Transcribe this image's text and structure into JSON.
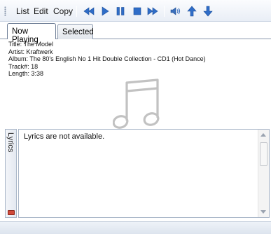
{
  "menu": {
    "list": "List",
    "edit": "Edit",
    "copy": "Copy"
  },
  "toolbar_icons": [
    "rewind-icon",
    "play-icon",
    "pause-icon",
    "stop-icon",
    "fast-forward-icon",
    "volume-icon",
    "arrow-up-icon",
    "arrow-down-icon"
  ],
  "colors": {
    "accent": "#3f7fd1",
    "icon_blue": "#2f6dc8"
  },
  "tabs": {
    "now_playing": "Now Playing",
    "selected": "Selected"
  },
  "track": {
    "title": "Title: The Model",
    "artist": "Artist: Kraftwerk",
    "album": "Album: The 80's English No 1 Hit Double Collection - CD1 (Hot Dance)",
    "track_no": "Track#: 18",
    "length": "Length: 3:38"
  },
  "lyrics": {
    "side_label": "Lyrics",
    "text": "Lyrics are not available."
  }
}
